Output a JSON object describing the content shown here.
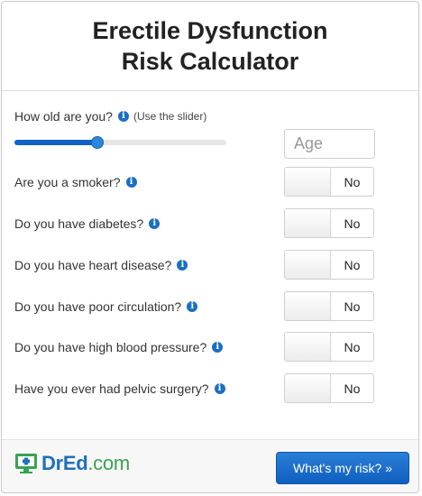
{
  "header": {
    "title_line1": "Erectile Dysfunction",
    "title_line2": "Risk Calculator"
  },
  "age": {
    "question": "How old are you?",
    "hint": "(Use the slider)",
    "placeholder": "Age",
    "slider_fraction": 0.39
  },
  "questions": [
    {
      "label": "Are you a smoker?",
      "value": "No"
    },
    {
      "label": "Do you have diabetes?",
      "value": "No"
    },
    {
      "label": "Do you have heart disease?",
      "value": "No"
    },
    {
      "label": "Do you have poor circulation?",
      "value": "No"
    },
    {
      "label": "Do you have high blood pressure?",
      "value": "No"
    },
    {
      "label": "Have you ever had pelvic surgery?",
      "value": "No"
    }
  ],
  "footer": {
    "logo_brand": "DrEd",
    "logo_domain": ".com",
    "button_label": "What's my risk? »"
  },
  "colors": {
    "accent": "#1261c7",
    "logo_green": "#3aa251",
    "info_icon": "#1a6fc4"
  },
  "icons": {
    "info": "info-icon",
    "logo": "monitor-cross-icon"
  }
}
